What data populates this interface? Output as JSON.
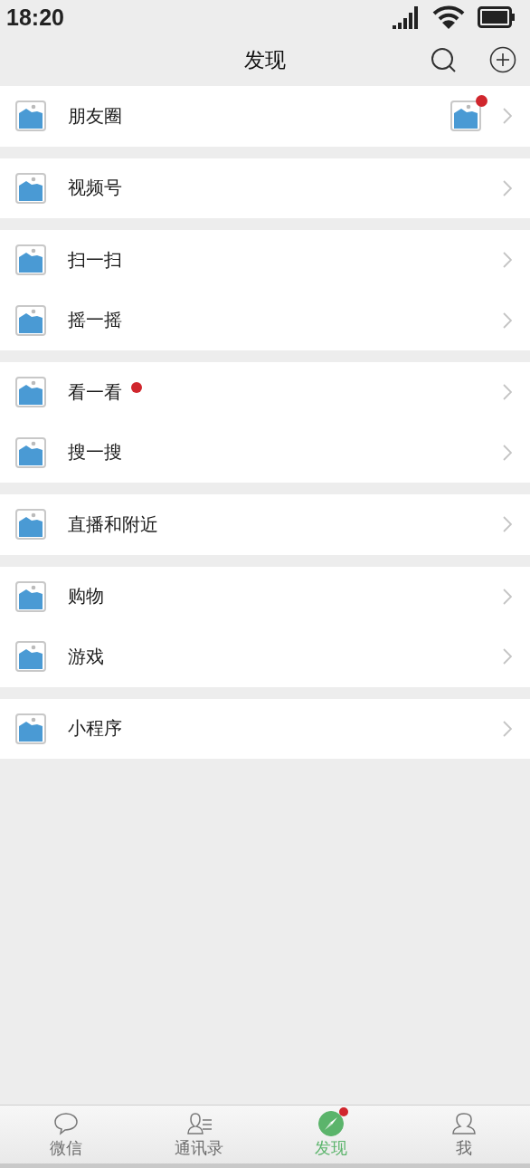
{
  "status_bar": {
    "time": "18:20"
  },
  "header": {
    "title": "发现"
  },
  "groups": [
    {
      "items": [
        {
          "label": "朋友圈",
          "dot": false,
          "preview": {
            "dot": true
          }
        }
      ]
    },
    {
      "items": [
        {
          "label": "视频号",
          "dot": false
        }
      ]
    },
    {
      "items": [
        {
          "label": "扫一扫",
          "dot": false
        },
        {
          "label": "摇一摇",
          "dot": false
        }
      ]
    },
    {
      "items": [
        {
          "label": "看一看",
          "dot": true
        },
        {
          "label": "搜一搜",
          "dot": false
        }
      ]
    },
    {
      "items": [
        {
          "label": "直播和附近",
          "dot": false
        }
      ]
    },
    {
      "items": [
        {
          "label": "购物",
          "dot": false
        },
        {
          "label": "游戏",
          "dot": false
        }
      ]
    },
    {
      "items": [
        {
          "label": "小程序",
          "dot": false
        }
      ]
    }
  ],
  "tabs": [
    {
      "kind": "chat",
      "label": "微信",
      "selected": false,
      "dot": false
    },
    {
      "kind": "contacts",
      "label": "通讯录",
      "selected": false,
      "dot": false
    },
    {
      "kind": "discover",
      "label": "发现",
      "selected": true,
      "dot": true
    },
    {
      "kind": "me",
      "label": "我",
      "selected": false,
      "dot": false
    }
  ]
}
